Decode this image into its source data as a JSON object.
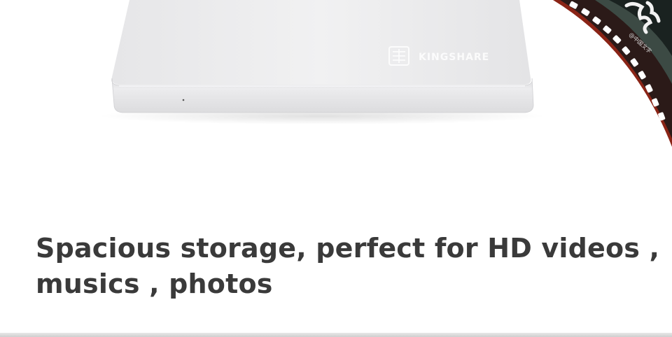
{
  "product": {
    "brand_text": "KINGSHARE"
  },
  "headline": {
    "line1": "Spacious storage, perfect for HD videos ,",
    "line2": "musics ,  photos"
  },
  "film_strip": {
    "label_text": "@中国文字"
  },
  "colors": {
    "drive_top": "#eeeeef",
    "drive_edge": "#e2e2e4",
    "film_base": "#2b1a18",
    "film_rim": "#7a1f14",
    "headline": "#3a3a3a"
  }
}
